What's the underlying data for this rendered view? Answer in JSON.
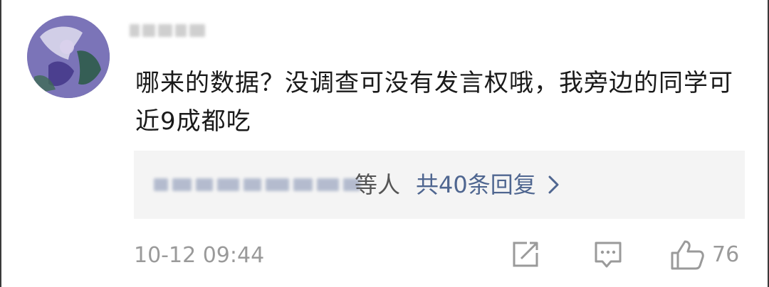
{
  "comment": {
    "text": "哪来的数据？没调查可没有发言权哦，我旁边的同学可近9成都吃",
    "timestamp": "10-12 09:44"
  },
  "replies": {
    "suffix": "等人",
    "link": "共40条回复"
  },
  "actions": {
    "like_count": "76"
  },
  "icons": {
    "share": "share-icon",
    "reply": "comment-icon",
    "like": "thumbs-up-icon",
    "chevron": "chevron-right-icon"
  },
  "colors": {
    "link": "#4f6690",
    "meta_text": "#9a9a9a",
    "reply_bg": "#f4f4f4"
  }
}
